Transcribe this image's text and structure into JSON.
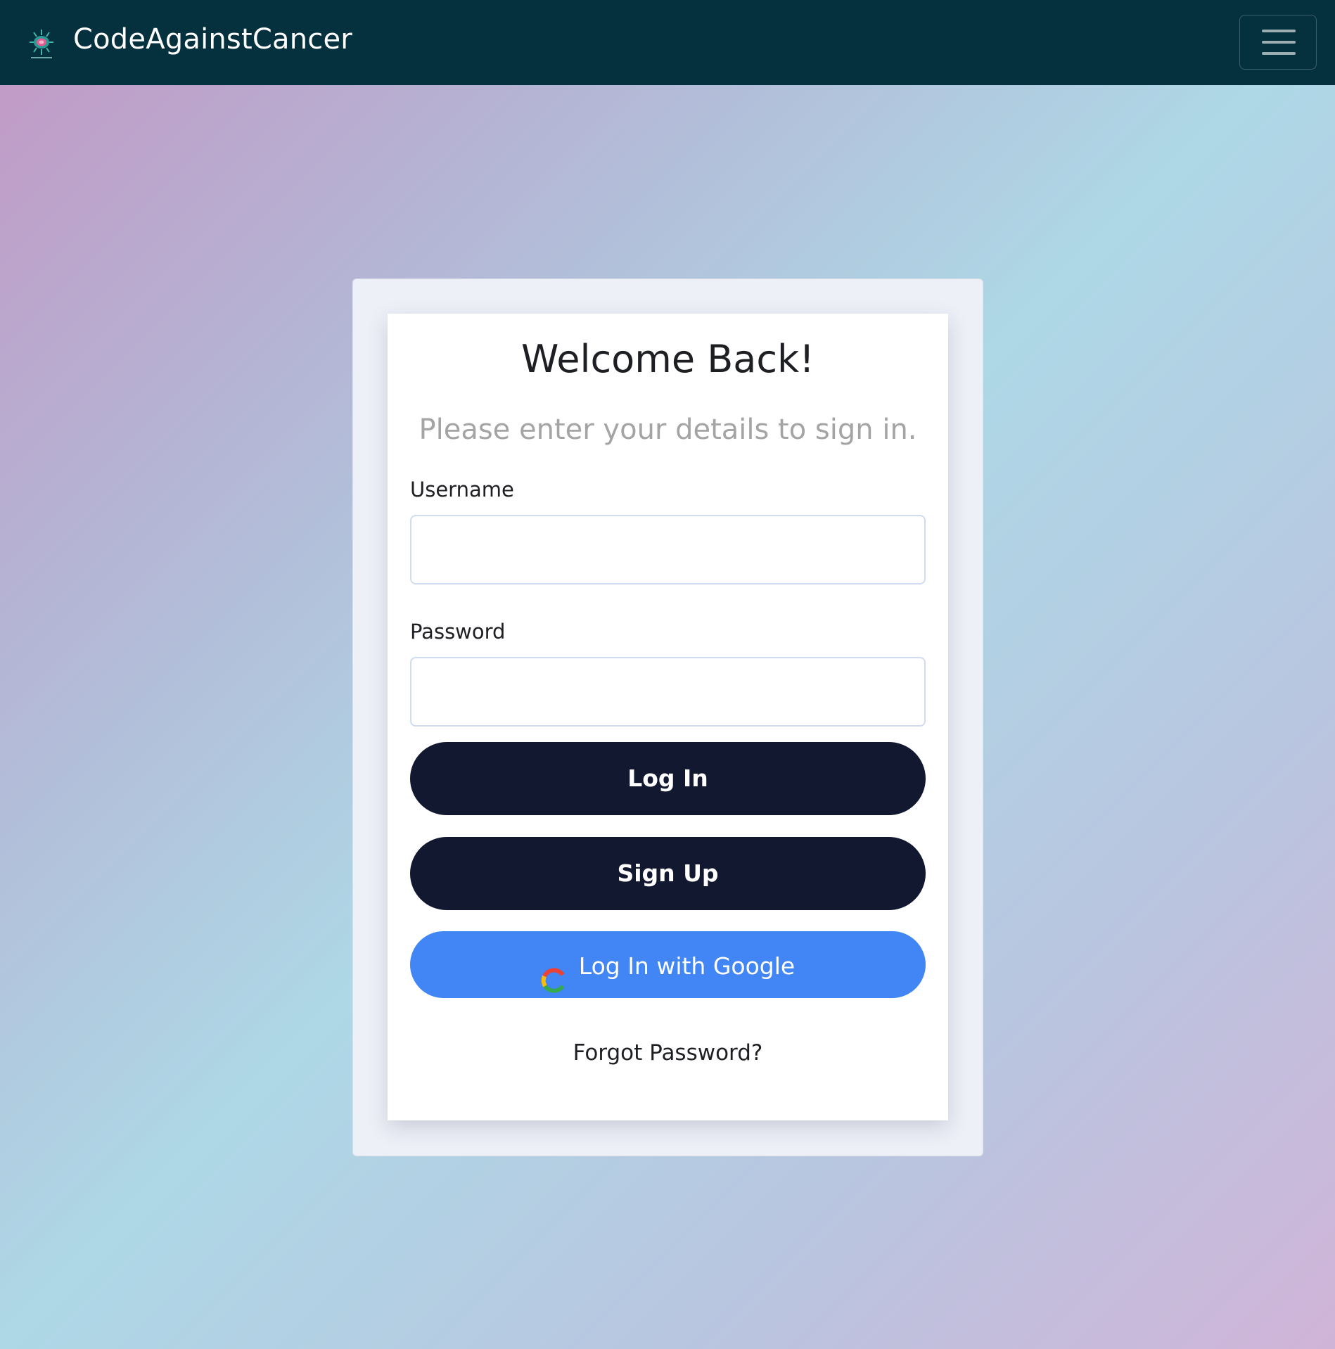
{
  "navbar": {
    "brand_title": "CodeAgainstCancer",
    "logo_icon": "bacteria-logo-icon",
    "menu_icon": "hamburger-menu-icon"
  },
  "login_card": {
    "title": "Welcome Back!",
    "subtitle": "Please enter your details to sign in.",
    "username_label": "Username",
    "username_value": "",
    "username_placeholder": "",
    "password_label": "Password",
    "password_value": "",
    "password_placeholder": "",
    "login_button": "Log In",
    "signup_button": "Sign Up",
    "google_button": "Log In with Google",
    "google_icon": "google-g-icon",
    "forgot_link": "Forgot Password?"
  },
  "colors": {
    "navbar_bg": "#05313f",
    "dark_button": "#12182f",
    "google_blue": "#4285f4",
    "gradient_start": "#c297c4",
    "gradient_mid": "#aed8e6",
    "gradient_end": "#d0b4d8"
  }
}
